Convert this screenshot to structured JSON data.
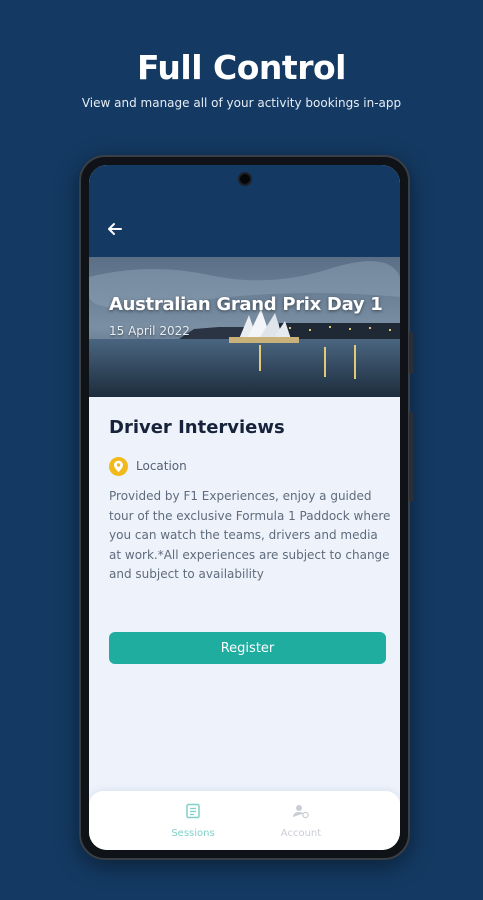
{
  "promo": {
    "title": "Full Control",
    "subtitle": "View and manage all of your activity bookings in-app"
  },
  "app": {
    "header": {
      "back_icon": "arrow-left-icon"
    },
    "event": {
      "title": "Australian Grand Prix Day 1",
      "date": "15 April 2022"
    },
    "session": {
      "title": "Driver Interviews",
      "location_icon": "location-pin-icon",
      "location_label": "Location",
      "description": "Provided by F1 Experiences, enjoy a guided tour of the exclusive Formula 1 Paddock where you can watch the teams, drivers and media at work.*All experiences are subject to change and subject to availability",
      "register_label": "Register"
    },
    "bottom_nav": {
      "items": [
        {
          "label": "Sessions",
          "icon": "sessions-list-icon",
          "active": true
        },
        {
          "label": "Account",
          "icon": "account-icon",
          "active": false
        }
      ]
    }
  },
  "colors": {
    "background": "#143a63",
    "accent": "#1fada0",
    "pin": "#f2b91a",
    "content_background": "#eef3fb"
  }
}
